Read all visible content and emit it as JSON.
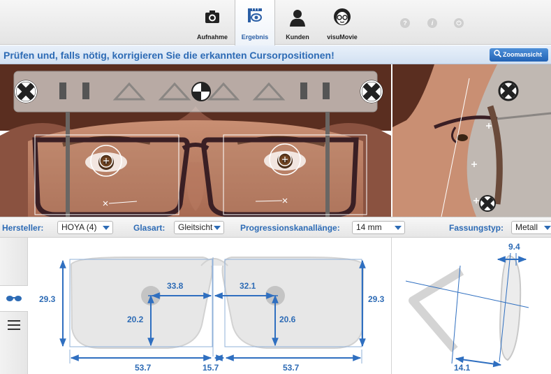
{
  "toolbar": {
    "tabs": [
      {
        "label": "Aufnahme",
        "icon": "camera-icon"
      },
      {
        "label": "Ergebnis",
        "icon": "measurement-icon"
      },
      {
        "label": "Kunden",
        "icon": "customer-icon"
      },
      {
        "label": "visuMovie",
        "icon": "visumovie-icon"
      }
    ],
    "active_tab": "Ergebnis",
    "small_icons": [
      {
        "icon": "help-icon",
        "glyph": "?"
      },
      {
        "icon": "info-icon",
        "glyph": "i"
      },
      {
        "icon": "exit-icon",
        "glyph": "⏻"
      }
    ]
  },
  "instruction": {
    "text": "Prüfen und, falls nötig, korrigieren Sie die erkannten Cursorpositionen!",
    "zoom_button": "Zoomansicht"
  },
  "selectors": {
    "hersteller": {
      "label": "Hersteller:",
      "value": "HOYA (4)"
    },
    "glasart": {
      "label": "Glasart:",
      "value": "Gleitsicht"
    },
    "progression": {
      "label": "Progressionskanallänge:",
      "value": "14 mm"
    },
    "fassungstyp": {
      "label": "Fassungstyp:",
      "value": "Metall"
    }
  },
  "sidebar": {
    "items": [
      {
        "icon": "glasses-icon",
        "active": true
      },
      {
        "icon": "menu-icon",
        "active": false
      }
    ]
  },
  "measurements": {
    "left_height": "29.3",
    "left_pd": "33.8",
    "left_fitting_height": "20.2",
    "left_width": "53.7",
    "bridge": "15.7",
    "right_pd": "32.1",
    "right_fitting_height": "20.6",
    "right_width": "53.7",
    "right_height": "29.3",
    "vertex": "9.4",
    "pantoscopic": "14.1"
  },
  "colors": {
    "accent": "#2d6bb5",
    "measure_line": "#2f6fc0"
  }
}
